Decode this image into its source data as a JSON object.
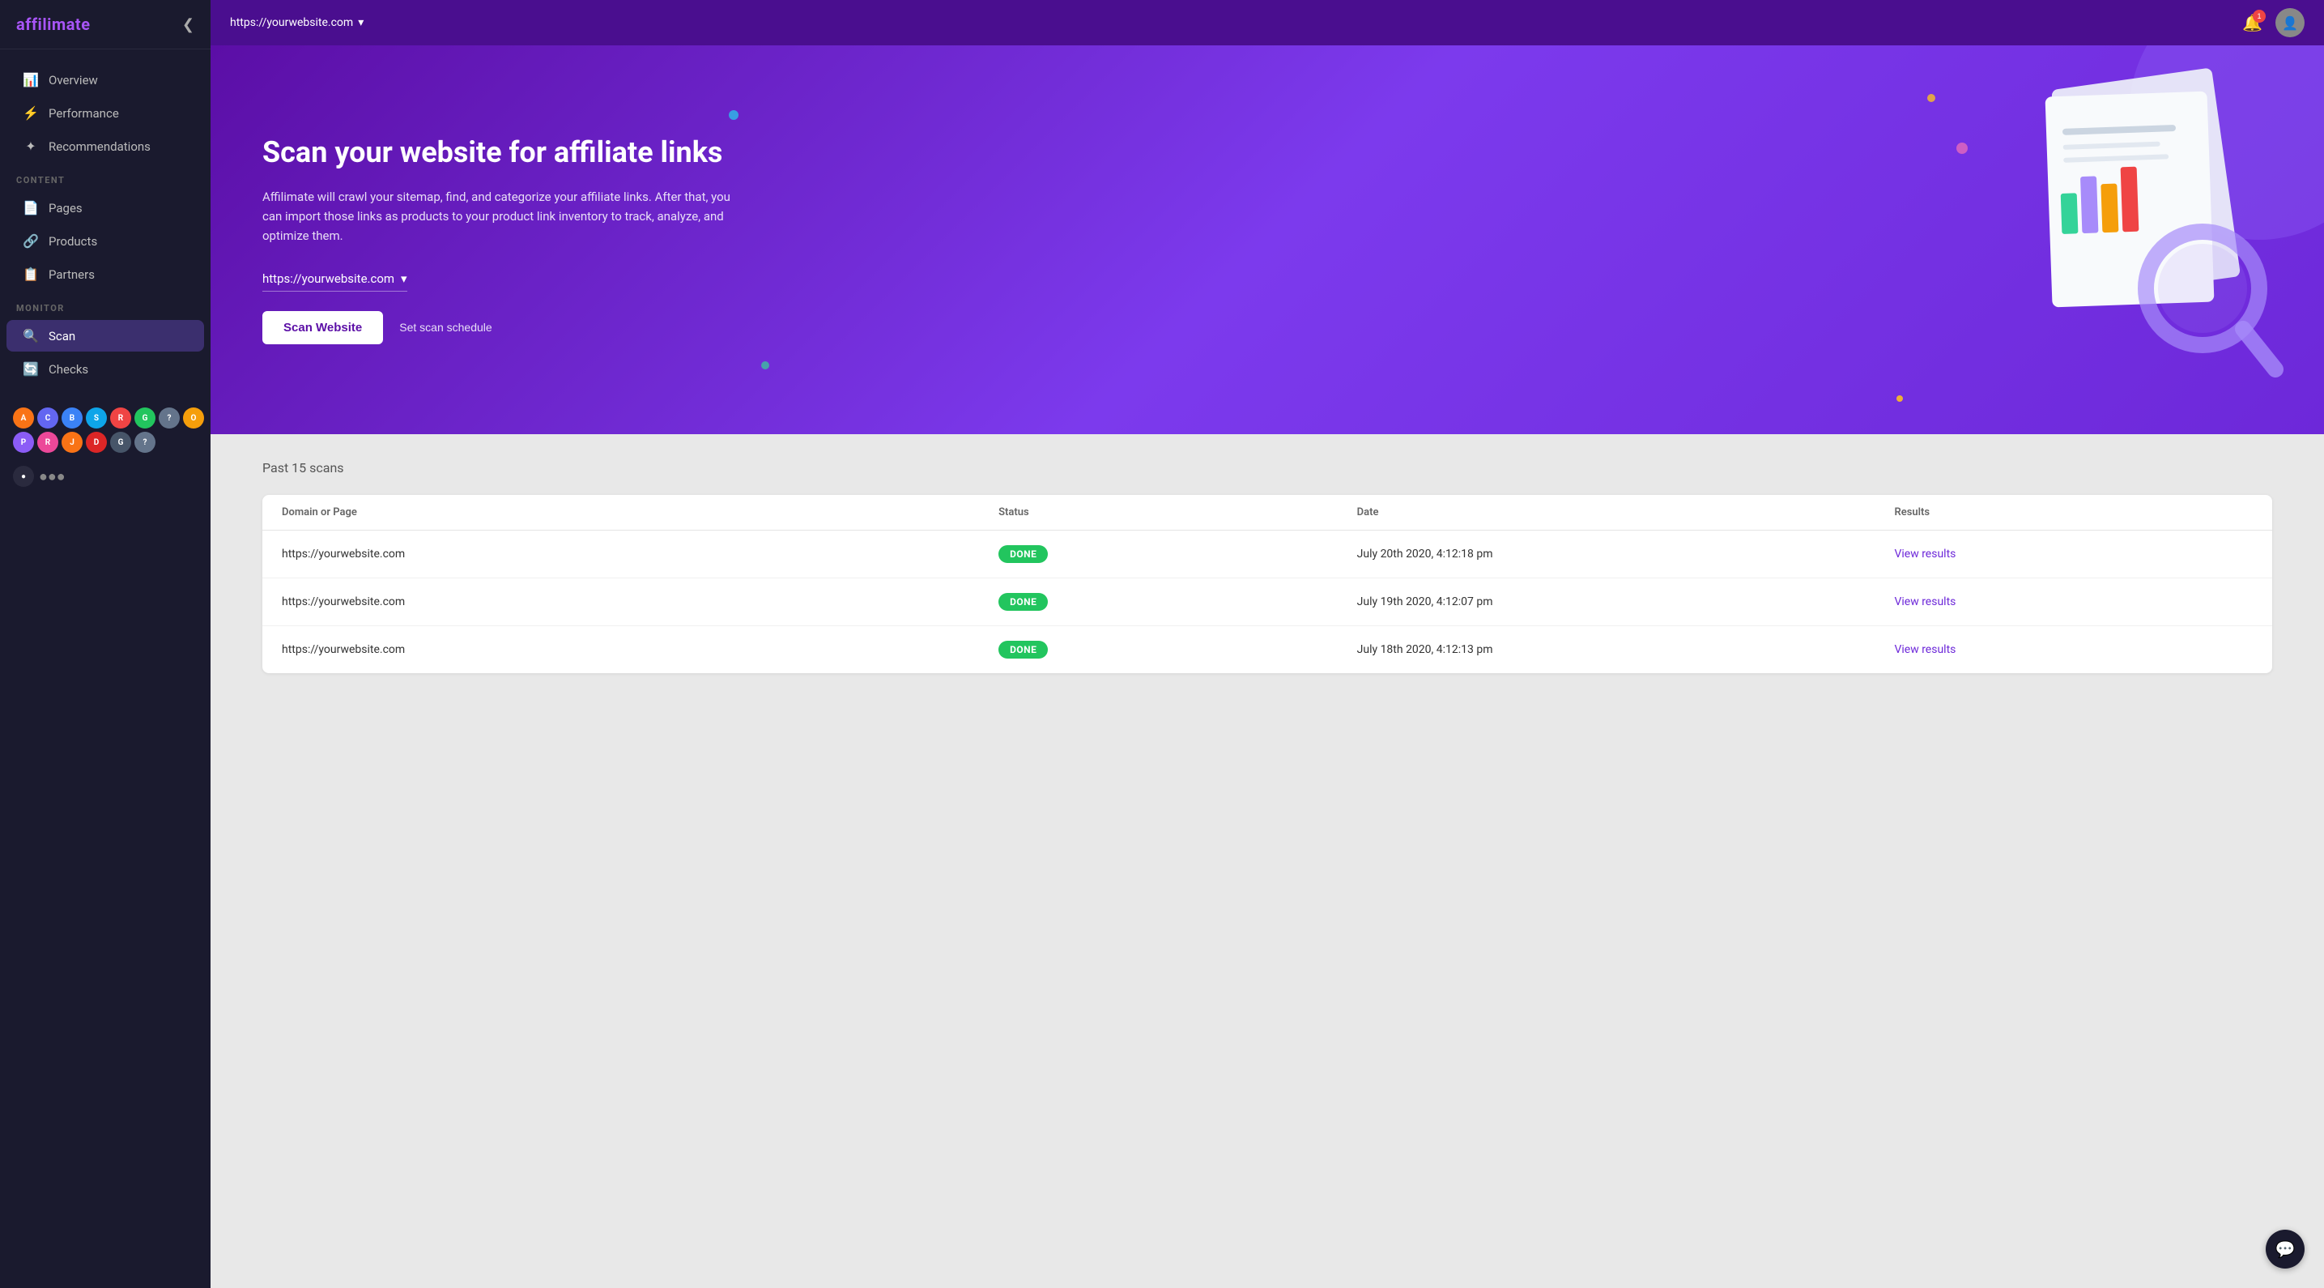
{
  "app": {
    "name": "affilimate",
    "name_highlight": "affi",
    "name_rest": "limate"
  },
  "topbar": {
    "url": "https://yourwebsite.com",
    "url_dropdown_icon": "▾",
    "notification_count": "1"
  },
  "sidebar": {
    "collapse_icon": "❮",
    "nav_items": [
      {
        "id": "overview",
        "label": "Overview",
        "icon": "📊"
      },
      {
        "id": "performance",
        "label": "Performance",
        "icon": "⚡"
      },
      {
        "id": "recommendations",
        "label": "Recommendations",
        "icon": "✦"
      }
    ],
    "content_section_label": "CONTENT",
    "content_items": [
      {
        "id": "pages",
        "label": "Pages",
        "icon": "📄"
      },
      {
        "id": "products",
        "label": "Products",
        "icon": "🔗"
      },
      {
        "id": "partners",
        "label": "Partners",
        "icon": "📋"
      }
    ],
    "monitor_section_label": "MONITOR",
    "monitor_items": [
      {
        "id": "scan",
        "label": "Scan",
        "icon": "🔍",
        "active": true
      },
      {
        "id": "checks",
        "label": "Checks",
        "icon": "🔄"
      }
    ],
    "partners": [
      {
        "id": "amazon",
        "color": "#f97316",
        "label": "A"
      },
      {
        "id": "cj",
        "color": "#6366f1",
        "label": "C"
      },
      {
        "id": "b",
        "color": "#3b82f6",
        "label": "B"
      },
      {
        "id": "skimlinks",
        "color": "#0ea5e9",
        "label": "S"
      },
      {
        "id": "red",
        "color": "#ef4444",
        "label": "R"
      },
      {
        "id": "g",
        "color": "#22c55e",
        "label": "G"
      },
      {
        "id": "q",
        "color": "#64748b",
        "label": "?"
      },
      {
        "id": "orange2",
        "color": "#f59e0b",
        "label": "O"
      },
      {
        "id": "p2",
        "color": "#8b5cf6",
        "label": "P"
      },
      {
        "id": "r2",
        "color": "#ec4899",
        "label": "R"
      },
      {
        "id": "j",
        "color": "#f97316",
        "label": "J"
      },
      {
        "id": "dark",
        "color": "#dc2626",
        "label": "D"
      },
      {
        "id": "g2",
        "color": "#475569",
        "label": "G"
      },
      {
        "id": "q2",
        "color": "#64748b",
        "label": "?"
      }
    ],
    "more_icon": "●●●",
    "more_circle_color": "#2a2a3e"
  },
  "hero": {
    "title": "Scan your website for affiliate links",
    "description": "Affilimate will crawl your sitemap, find, and categorize your affiliate links. After that, you can import those links as products to your product link inventory to track, analyze, and optimize them.",
    "url_select_label": "https://yourwebsite.com",
    "scan_button_label": "Scan Website",
    "schedule_button_label": "Set scan schedule"
  },
  "scans": {
    "section_title": "Past 15 scans",
    "table_headers": {
      "domain": "Domain or Page",
      "status": "Status",
      "date": "Date",
      "results": "Results"
    },
    "rows": [
      {
        "domain": "https://yourwebsite.com",
        "status": "DONE",
        "date": "July 20th 2020, 4:12:18 pm",
        "results": "View results"
      },
      {
        "domain": "https://yourwebsite.com",
        "status": "DONE",
        "date": "July 19th 2020, 4:12:07 pm",
        "results": "View results"
      },
      {
        "domain": "https://yourwebsite.com",
        "status": "DONE",
        "date": "July 18th 2020, 4:12:13 pm",
        "results": "View results"
      }
    ]
  }
}
